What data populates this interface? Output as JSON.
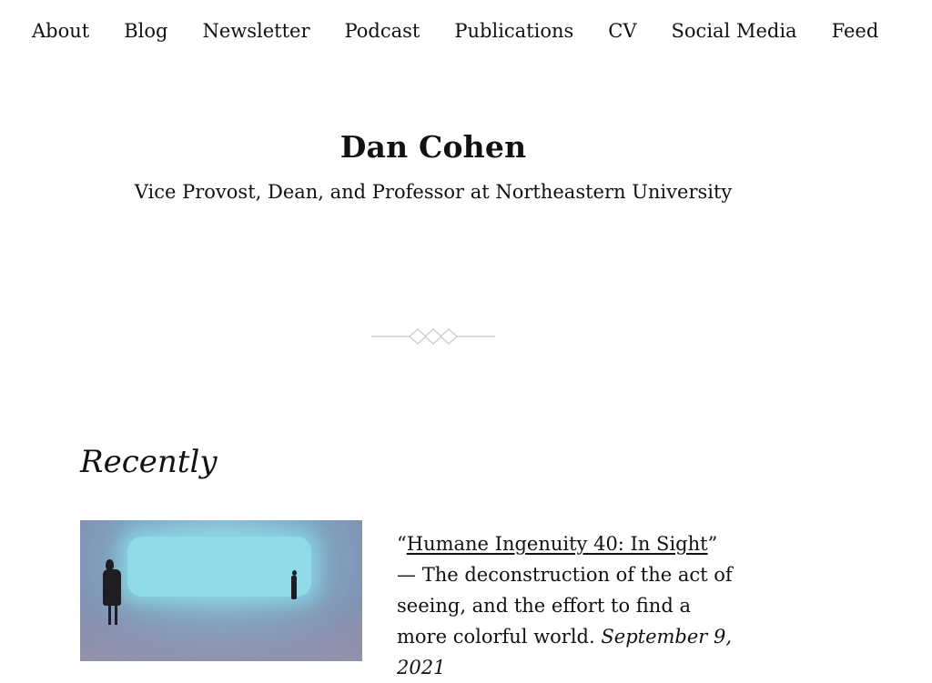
{
  "nav": {
    "items": [
      "About",
      "Blog",
      "Newsletter",
      "Podcast",
      "Publications",
      "CV",
      "Social Media",
      "Feed"
    ]
  },
  "header": {
    "title": "Dan Cohen",
    "subtitle": "Vice Provost, Dean, and Professor at Northeastern University"
  },
  "recent": {
    "heading": "Recently",
    "entry": {
      "open_quote": "“",
      "title": "Humane Ingenuity 40: In Sight",
      "close_quote_dash": "” —",
      "description": "The deconstruction of the act of seeing, and the effort to find a more colorful world.",
      "date": "September 9, 2021"
    }
  }
}
